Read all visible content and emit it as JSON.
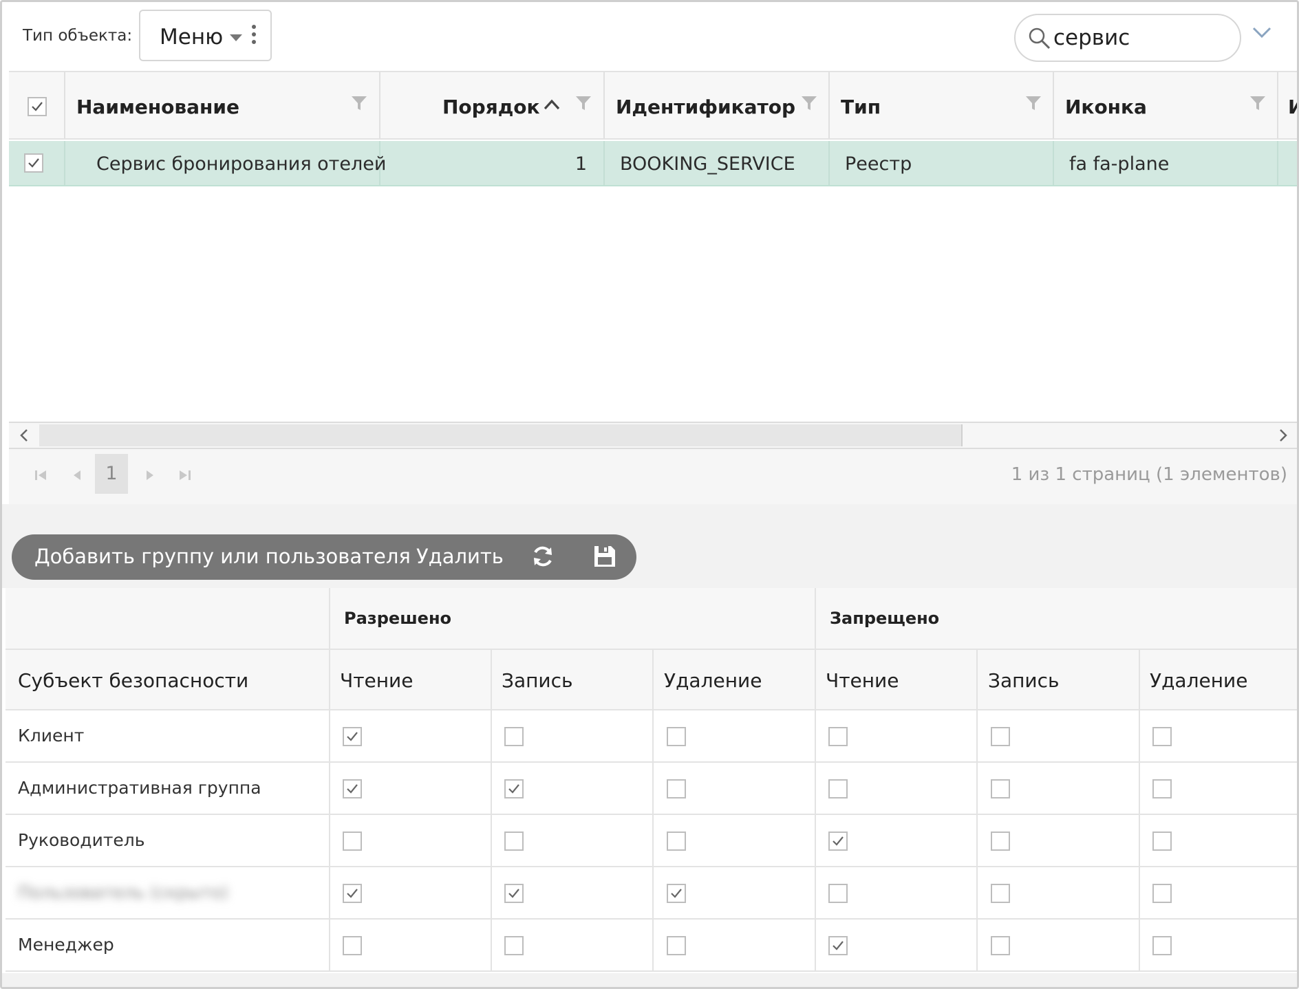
{
  "toolbar": {
    "type_label": "Тип объекта:",
    "type_value": "Меню",
    "search_value": "сервис"
  },
  "grid": {
    "columns": [
      "Наименование",
      "Порядок",
      "Идентификатор",
      "Тип",
      "Иконка",
      "И"
    ],
    "sort_column": "Порядок",
    "sort_direction": "ascending",
    "rows": [
      {
        "selected": true,
        "name": "Сервис бронирования отелей",
        "order": "1",
        "identifier": "BOOKING_SERVICE",
        "type": "Реестр",
        "icon": "fa fa-plane"
      }
    ]
  },
  "pager": {
    "current_page": "1",
    "info": "1 из 1 страниц (1 элементов)"
  },
  "actions": {
    "add_label": "Добавить группу или пользователя",
    "delete_label": "Удалить",
    "refresh_icon": "refresh-icon",
    "save_icon": "save-icon"
  },
  "permissions": {
    "group_allowed": "Разрешено",
    "group_denied": "Запрещено",
    "subject_header": "Субъект безопасности",
    "headers": [
      "Чтение",
      "Запись",
      "Удаление",
      "Чтение",
      "Запись",
      "Удаление"
    ],
    "rows": [
      {
        "subject": "Клиент",
        "blurred": false,
        "checks": [
          true,
          false,
          false,
          false,
          false,
          false
        ]
      },
      {
        "subject": "Административная группа",
        "blurred": false,
        "checks": [
          true,
          true,
          false,
          false,
          false,
          false
        ]
      },
      {
        "subject": "Руководитель",
        "blurred": false,
        "checks": [
          false,
          false,
          false,
          true,
          false,
          false
        ]
      },
      {
        "subject": "Пользователь (скрыто)",
        "blurred": true,
        "checks": [
          true,
          true,
          true,
          false,
          false,
          false
        ]
      },
      {
        "subject": "Менеджер",
        "blurred": false,
        "checks": [
          false,
          false,
          false,
          true,
          false,
          false
        ]
      }
    ]
  },
  "colors": {
    "selected_row": "#d3e9e1",
    "action_bar": "#777777",
    "header_bg": "#f7f7f7"
  }
}
